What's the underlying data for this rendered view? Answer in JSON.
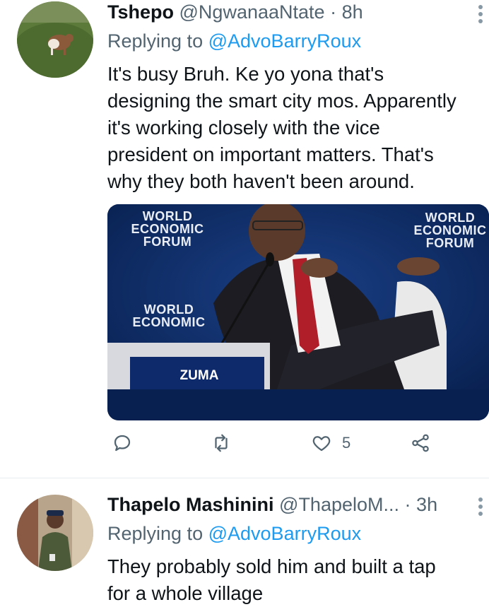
{
  "tweets": [
    {
      "name": "Tshepo",
      "handle": "@NgwanaaNtate",
      "separator": "·",
      "time": "8h",
      "replying_prefix": "Replying to",
      "replying_to": "@AdvoBarryRoux",
      "text": "It's busy Bruh. Ke yo yona that's\ndesigning the smart city mos. Apparently\nit's working closely with the vice\npresident on important matters. That's\nwhy they both haven't been around.",
      "media": {
        "wef_line1": "WORLD",
        "wef_line2": "ECONOMIC",
        "wef_line3": "FORUM",
        "nameplate": "ZUMA"
      },
      "actions": {
        "like_count": "5"
      }
    },
    {
      "name": "Thapelo Mashinini",
      "handle": "@ThapeloM...",
      "separator": "·",
      "time": "3h",
      "replying_prefix": "Replying to",
      "replying_to": "@AdvoBarryRoux",
      "text": "They probably sold him and built a tap\nfor a whole village"
    }
  ],
  "icons": [
    "reply-icon",
    "retweet-icon",
    "like-icon",
    "share-icon",
    "more-icon"
  ],
  "colors": {
    "link": "#1d9bf0",
    "secondary": "#536471",
    "text": "#0f1419",
    "divider": "#e6ecf0"
  }
}
